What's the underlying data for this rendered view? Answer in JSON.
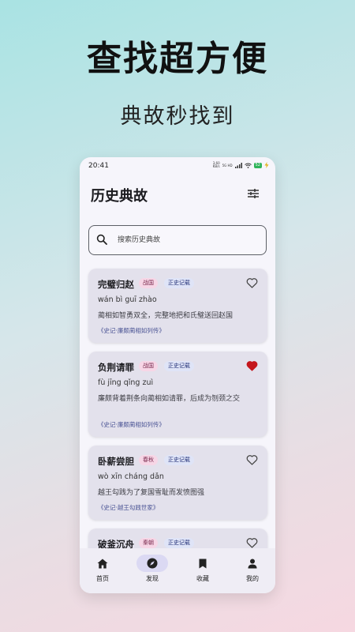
{
  "promo": {
    "title": "查找超方便",
    "subtitle": "典故秒找到"
  },
  "status_bar": {
    "time": "20:41",
    "net_speed_value": "3.60",
    "net_speed_unit": "KB/s",
    "network_label": "5G HD",
    "battery": "52"
  },
  "header": {
    "title": "历史典故",
    "filter_icon": "sliders-icon"
  },
  "search": {
    "placeholder": "搜索历史典故",
    "value": ""
  },
  "items": [
    {
      "title": "完璧归赵",
      "era": "战国",
      "record": "正史记载",
      "pinyin": "wán bì guī zhào",
      "desc": "蔺相如智勇双全，完整地把和氏璧送回赵国",
      "source": "《史记·廉颇蔺相如列传》",
      "favorited": false
    },
    {
      "title": "负荆请罪",
      "era": "战国",
      "record": "正史记载",
      "pinyin": "fù jīng qǐng zuì",
      "desc": "廉颇背着荆条向蔺相如请罪，后成为刎颈之交",
      "source": "《史记·廉颇蔺相如列传》",
      "favorited": true
    },
    {
      "title": "卧薪尝胆",
      "era": "春秋",
      "record": "正史记载",
      "pinyin": "wò xīn cháng dǎn",
      "desc": "越王勾践为了复国雪耻而发愤图强",
      "source": "《史记·越王勾践世家》",
      "favorited": false
    },
    {
      "title": "破釜沉舟",
      "era": "秦朝",
      "record": "正史记载",
      "favorited": false
    }
  ],
  "nav": [
    {
      "label": "首页",
      "icon": "home-icon"
    },
    {
      "label": "发现",
      "icon": "compass-icon"
    },
    {
      "label": "收藏",
      "icon": "bookmark-icon"
    },
    {
      "label": "我的",
      "icon": "person-icon"
    }
  ],
  "colors": {
    "heart_active": "#c4161c",
    "accent": "#dbd9f3"
  }
}
